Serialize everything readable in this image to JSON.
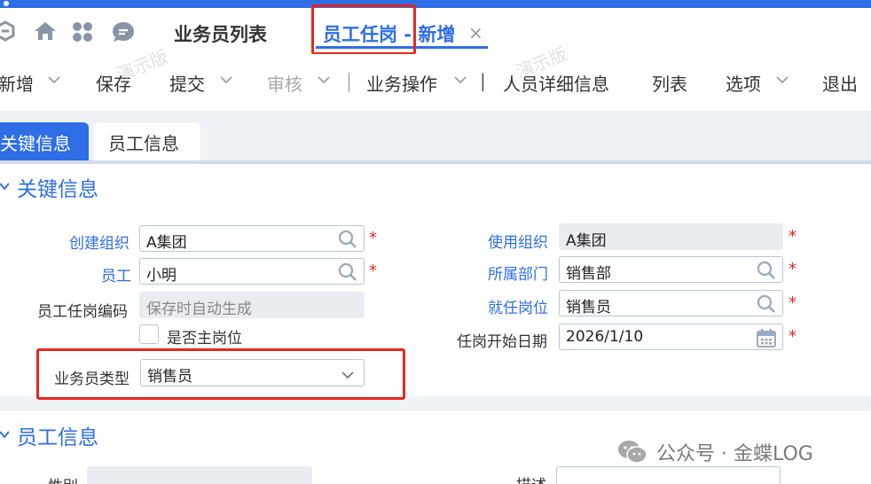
{
  "page_tabs": {
    "list_label": "业务员列表",
    "active_label": "员工任岗 - 新增",
    "close_glyph": "×"
  },
  "watermark": "演示版",
  "toolbar": {
    "new": "新增",
    "save": "保存",
    "submit": "提交",
    "audit": "审核",
    "business_ops": "业务操作",
    "separator": "|",
    "person_detail": "人员详细信息",
    "list": "列表",
    "options": "选项",
    "exit": "退出"
  },
  "form_tabs": {
    "key_info": "关键信息",
    "employee_info": "员工信息"
  },
  "sections": {
    "key_info_title": "关键信息",
    "employee_info_title": "员工信息"
  },
  "fields": {
    "create_org": {
      "label": "创建组织",
      "value": "A集团",
      "required": "*"
    },
    "use_org": {
      "label": "使用组织",
      "value": "A集团",
      "required": "*"
    },
    "employee": {
      "label": "员工",
      "value": "小明",
      "required": "*"
    },
    "department": {
      "label": "所属部门",
      "value": "销售部",
      "required": "*"
    },
    "post_code": {
      "label": "员工任岗编码",
      "value": "保存时自动生成"
    },
    "position": {
      "label": "就任岗位",
      "value": "销售员",
      "required": "*"
    },
    "is_main_post": {
      "label": "是否主岗位",
      "checked": false
    },
    "start_date": {
      "label": "任岗开始日期",
      "value": "2026/1/10",
      "required": "*"
    },
    "salesman_type": {
      "label": "业务员类型",
      "value": "销售员"
    },
    "gender": {
      "label": "性别",
      "value": ""
    },
    "description": {
      "label": "描述",
      "value": ""
    }
  },
  "footer_watermark": "公众号 · 金蝶LOG",
  "colors": {
    "accent": "#2e6ee6",
    "highlight_box": "#e8261e",
    "required": "#e8261e",
    "background": "#eef1f6"
  },
  "icons": {
    "app_icons": [
      "logo-icon",
      "home-icon",
      "apps-grid-icon",
      "chat-bubble-icon"
    ],
    "field_icons": [
      "search-icon",
      "calendar-icon",
      "chevron-down-icon"
    ]
  }
}
